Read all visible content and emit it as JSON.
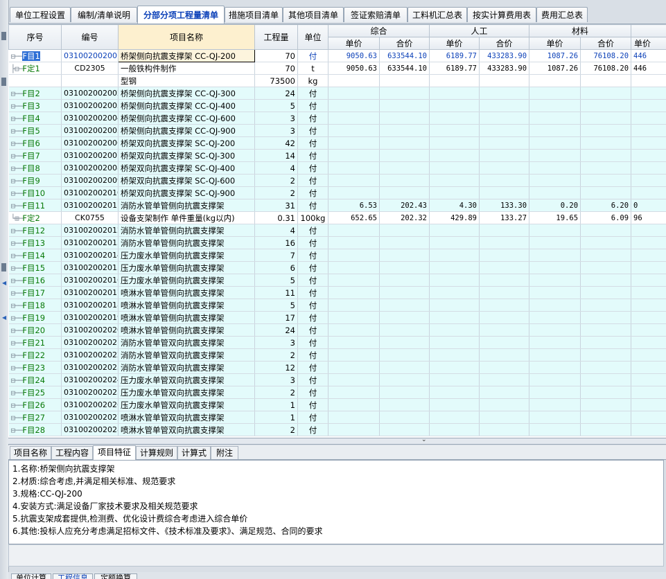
{
  "tabs": [
    {
      "label": "单位工程设置",
      "active": false
    },
    {
      "label": "编制/清单说明",
      "active": false
    },
    {
      "label": "分部分项工程量清单",
      "active": true
    },
    {
      "label": "措施项目清单",
      "active": false
    },
    {
      "label": "其他项目清单",
      "active": false
    },
    {
      "label": "签证索赔清单",
      "active": false
    },
    {
      "label": "工料机汇总表",
      "active": false
    },
    {
      "label": "按实计算费用表",
      "active": false
    },
    {
      "label": "费用汇总表",
      "active": false
    }
  ],
  "columns": {
    "seq": "序号",
    "code": "编号",
    "name": "项目名称",
    "qty": "工程量",
    "unit": "单位",
    "groups": [
      "综合",
      "人工",
      "材料"
    ],
    "sub": [
      "单价",
      "合价",
      "单价",
      "合价",
      "单价",
      "合价",
      "单价"
    ]
  },
  "rows": [
    {
      "kind": "F",
      "tree": "⊟──",
      "label": "F目1",
      "code": "031002002001",
      "name": "桥架侧向抗震支撑架 CC-QJ-200",
      "qty": "70",
      "unit": "付",
      "vals": [
        "9050.63",
        "633544.10",
        "6189.77",
        "433283.90",
        "1087.26",
        "76108.20",
        "446"
      ],
      "bg": "white",
      "selected": true
    },
    {
      "kind": "D",
      "tree": "├⊟─",
      "label": "F定1",
      "code": "CD2305",
      "name": "一般铁构件制作",
      "qty": "70",
      "unit": "t",
      "vals": [
        "9050.63",
        "633544.10",
        "6189.77",
        "433283.90",
        "1087.26",
        "76108.20",
        "446"
      ],
      "bg": "white"
    },
    {
      "kind": "M",
      "tree": "",
      "label": "",
      "code": "",
      "name": "型钢",
      "qty": "73500",
      "unit": "kg",
      "vals": [
        "",
        "",
        "",
        "",
        "",
        "",
        ""
      ],
      "bg": "white"
    },
    {
      "kind": "F",
      "tree": "⊟──",
      "label": "F目2",
      "code": "031002002002",
      "name": "桥架侧向抗震支撑架 CC-QJ-300",
      "qty": "24",
      "unit": "付",
      "vals": [
        "",
        "",
        "",
        "",
        "",
        "",
        ""
      ],
      "bg": "cyan"
    },
    {
      "kind": "F",
      "tree": "⊟──",
      "label": "F目3",
      "code": "031002002003",
      "name": "桥架侧向抗震支撑架 CC-QJ-400",
      "qty": "5",
      "unit": "付",
      "vals": [
        "",
        "",
        "",
        "",
        "",
        "",
        ""
      ],
      "bg": "cyan"
    },
    {
      "kind": "F",
      "tree": "⊟──",
      "label": "F目4",
      "code": "031002002004",
      "name": "桥架侧向抗震支撑架 CC-QJ-600",
      "qty": "3",
      "unit": "付",
      "vals": [
        "",
        "",
        "",
        "",
        "",
        "",
        ""
      ],
      "bg": "cyan"
    },
    {
      "kind": "F",
      "tree": "⊟──",
      "label": "F目5",
      "code": "031002002005",
      "name": "桥架侧向抗震支撑架 CC-QJ-900",
      "qty": "3",
      "unit": "付",
      "vals": [
        "",
        "",
        "",
        "",
        "",
        "",
        ""
      ],
      "bg": "cyan"
    },
    {
      "kind": "F",
      "tree": "⊟──",
      "label": "F目6",
      "code": "031002002006",
      "name": "桥架双向抗震支撑架 SC-QJ-200",
      "qty": "42",
      "unit": "付",
      "vals": [
        "",
        "",
        "",
        "",
        "",
        "",
        ""
      ],
      "bg": "cyan"
    },
    {
      "kind": "F",
      "tree": "⊟──",
      "label": "F目7",
      "code": "031002002007",
      "name": "桥架双向抗震支撑架 SC-QJ-300",
      "qty": "14",
      "unit": "付",
      "vals": [
        "",
        "",
        "",
        "",
        "",
        "",
        ""
      ],
      "bg": "cyan"
    },
    {
      "kind": "F",
      "tree": "⊟──",
      "label": "F目8",
      "code": "031002002008",
      "name": "桥架双向抗震支撑架 SC-QJ-400",
      "qty": "4",
      "unit": "付",
      "vals": [
        "",
        "",
        "",
        "",
        "",
        "",
        ""
      ],
      "bg": "cyan"
    },
    {
      "kind": "F",
      "tree": "⊟──",
      "label": "F目9",
      "code": "031002002009",
      "name": "桥架双向抗震支撑架 SC-QJ-600",
      "qty": "2",
      "unit": "付",
      "vals": [
        "",
        "",
        "",
        "",
        "",
        "",
        ""
      ],
      "bg": "cyan"
    },
    {
      "kind": "F",
      "tree": "⊟──",
      "label": "F目10",
      "code": "031002002010",
      "name": "桥架双向抗震支撑架 SC-QJ-900",
      "qty": "2",
      "unit": "付",
      "vals": [
        "",
        "",
        "",
        "",
        "",
        "",
        ""
      ],
      "bg": "cyan"
    },
    {
      "kind": "F",
      "tree": "⊟──",
      "label": "F目11",
      "code": "031002002011",
      "name": "消防水管单管侧向抗震支撑架",
      "qty": "31",
      "unit": "付",
      "vals": [
        "6.53",
        "202.43",
        "4.30",
        "133.30",
        "0.20",
        "6.20",
        "0"
      ],
      "bg": "cyan"
    },
    {
      "kind": "D",
      "tree": "└⊞─",
      "label": "F定2",
      "code": "CK0755",
      "name": "设备支架制作 单件重量(kg以内)",
      "qty": "0.31",
      "unit": "100kg",
      "vals": [
        "652.65",
        "202.32",
        "429.89",
        "133.27",
        "19.65",
        "6.09",
        "96"
      ],
      "bg": "white"
    },
    {
      "kind": "F",
      "tree": "⊟──",
      "label": "F目12",
      "code": "031002002012",
      "name": "消防水管单管侧向抗震支撑架",
      "qty": "4",
      "unit": "付",
      "vals": [
        "",
        "",
        "",
        "",
        "",
        "",
        ""
      ],
      "bg": "cyan"
    },
    {
      "kind": "F",
      "tree": "⊟──",
      "label": "F目13",
      "code": "031002002013",
      "name": "消防水管单管侧向抗震支撑架",
      "qty": "16",
      "unit": "付",
      "vals": [
        "",
        "",
        "",
        "",
        "",
        "",
        ""
      ],
      "bg": "cyan"
    },
    {
      "kind": "F",
      "tree": "⊟──",
      "label": "F目14",
      "code": "031002002014",
      "name": "压力废水单管侧向抗震支撑架",
      "qty": "7",
      "unit": "付",
      "vals": [
        "",
        "",
        "",
        "",
        "",
        "",
        ""
      ],
      "bg": "cyan"
    },
    {
      "kind": "F",
      "tree": "⊟──",
      "label": "F目15",
      "code": "031002002015",
      "name": "压力废水单管侧向抗震支撑架",
      "qty": "6",
      "unit": "付",
      "vals": [
        "",
        "",
        "",
        "",
        "",
        "",
        ""
      ],
      "bg": "cyan"
    },
    {
      "kind": "F",
      "tree": "⊟──",
      "label": "F目16",
      "code": "031002002016",
      "name": "压力废水单管侧向抗震支撑架",
      "qty": "5",
      "unit": "付",
      "vals": [
        "",
        "",
        "",
        "",
        "",
        "",
        ""
      ],
      "bg": "cyan"
    },
    {
      "kind": "F",
      "tree": "⊟──",
      "label": "F目17",
      "code": "031002002017",
      "name": "喷淋水管单管侧向抗震支撑架",
      "qty": "11",
      "unit": "付",
      "vals": [
        "",
        "",
        "",
        "",
        "",
        "",
        ""
      ],
      "bg": "cyan"
    },
    {
      "kind": "F",
      "tree": "⊟──",
      "label": "F目18",
      "code": "031002002018",
      "name": "喷淋水管单管侧向抗震支撑架",
      "qty": "5",
      "unit": "付",
      "vals": [
        "",
        "",
        "",
        "",
        "",
        "",
        ""
      ],
      "bg": "cyan"
    },
    {
      "kind": "F",
      "tree": "⊟──",
      "label": "F目19",
      "code": "031002002019",
      "name": "喷淋水管单管侧向抗震支撑架",
      "qty": "17",
      "unit": "付",
      "vals": [
        "",
        "",
        "",
        "",
        "",
        "",
        ""
      ],
      "bg": "cyan"
    },
    {
      "kind": "F",
      "tree": "⊟──",
      "label": "F目20",
      "code": "031002002020",
      "name": "喷淋水管单管侧向抗震支撑架",
      "qty": "24",
      "unit": "付",
      "vals": [
        "",
        "",
        "",
        "",
        "",
        "",
        ""
      ],
      "bg": "cyan"
    },
    {
      "kind": "F",
      "tree": "⊟──",
      "label": "F目21",
      "code": "031002002021",
      "name": "消防水管单管双向抗震支撑架",
      "qty": "3",
      "unit": "付",
      "vals": [
        "",
        "",
        "",
        "",
        "",
        "",
        ""
      ],
      "bg": "cyan"
    },
    {
      "kind": "F",
      "tree": "⊟──",
      "label": "F目22",
      "code": "031002002022",
      "name": "消防水管单管双向抗震支撑架",
      "qty": "2",
      "unit": "付",
      "vals": [
        "",
        "",
        "",
        "",
        "",
        "",
        ""
      ],
      "bg": "cyan"
    },
    {
      "kind": "F",
      "tree": "⊟──",
      "label": "F目23",
      "code": "031002002023",
      "name": "消防水管单管双向抗震支撑架",
      "qty": "12",
      "unit": "付",
      "vals": [
        "",
        "",
        "",
        "",
        "",
        "",
        ""
      ],
      "bg": "cyan"
    },
    {
      "kind": "F",
      "tree": "⊟──",
      "label": "F目24",
      "code": "031002002024",
      "name": "压力废水单管双向抗震支撑架",
      "qty": "3",
      "unit": "付",
      "vals": [
        "",
        "",
        "",
        "",
        "",
        "",
        ""
      ],
      "bg": "cyan"
    },
    {
      "kind": "F",
      "tree": "⊟──",
      "label": "F目25",
      "code": "031002002025",
      "name": "压力废水单管双向抗震支撑架",
      "qty": "2",
      "unit": "付",
      "vals": [
        "",
        "",
        "",
        "",
        "",
        "",
        ""
      ],
      "bg": "cyan"
    },
    {
      "kind": "F",
      "tree": "⊟──",
      "label": "F目26",
      "code": "031002002026",
      "name": "压力废水单管双向抗震支撑架",
      "qty": "1",
      "unit": "付",
      "vals": [
        "",
        "",
        "",
        "",
        "",
        "",
        ""
      ],
      "bg": "cyan"
    },
    {
      "kind": "F",
      "tree": "⊟──",
      "label": "F目27",
      "code": "031002002027",
      "name": "喷淋水管单管双向抗震支撑架",
      "qty": "1",
      "unit": "付",
      "vals": [
        "",
        "",
        "",
        "",
        "",
        "",
        ""
      ],
      "bg": "cyan"
    },
    {
      "kind": "F",
      "tree": "⊟──",
      "label": "F目28",
      "code": "031002002028",
      "name": "喷淋水管单管双向抗震支撑架",
      "qty": "2",
      "unit": "付",
      "vals": [
        "",
        "",
        "",
        "",
        "",
        "",
        ""
      ],
      "bg": "cyan"
    }
  ],
  "bottom_tabs": [
    {
      "label": "项目名称",
      "active": false
    },
    {
      "label": "工程内容",
      "active": false
    },
    {
      "label": "项目特征",
      "active": true
    },
    {
      "label": "计算规则",
      "active": false
    },
    {
      "label": "计算式",
      "active": false
    },
    {
      "label": "附注",
      "active": false
    }
  ],
  "features": [
    "1.名称:桥架侧向抗震支撑架",
    "2.材质:综合考虑,并满足相关标准、规范要求",
    "3.规格:CC-QJ-200",
    "4.安装方式:满足设备厂家技术要求及相关规范要求",
    "5.抗震支架成套提供,检测费、优化设计费综合考虑进入综合单价",
    "6.其他:投标人应充分考虑满足招标文件、《技术标准及要求》、满足规范、合同的要求"
  ],
  "footer_tabs": [
    "单位计算",
    "工程信息",
    "定额换算"
  ],
  "colors": {
    "row_cyan": "#e3fbfb",
    "seq_green": "#097a09",
    "selected_blue": "#0b40b8",
    "active_tab": "#0b40b8"
  }
}
